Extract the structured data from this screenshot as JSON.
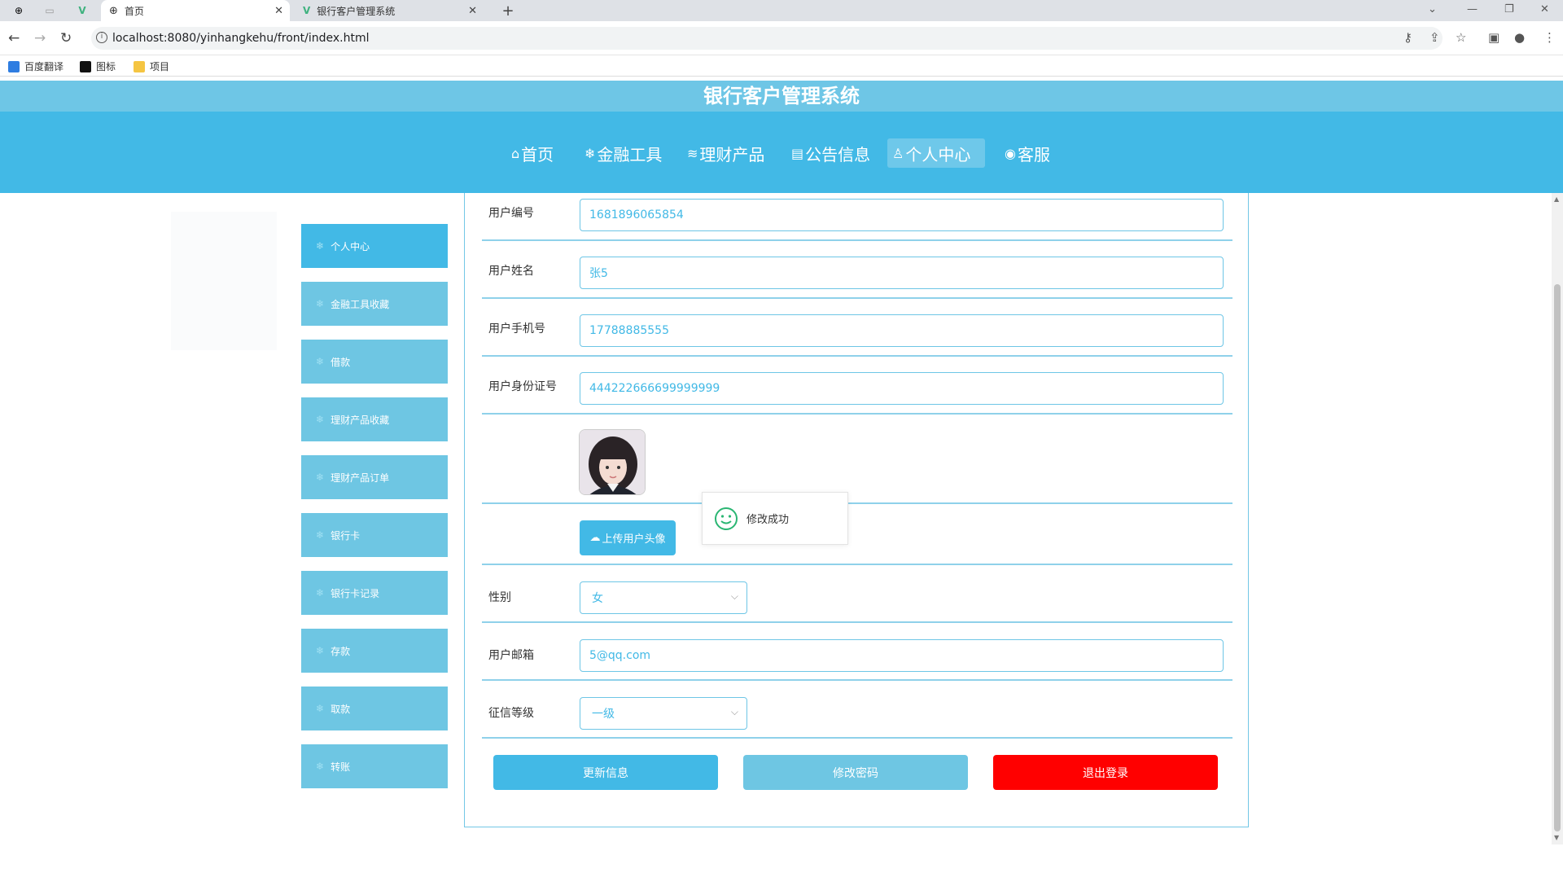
{
  "browser": {
    "tabs": [
      {
        "title": "首页",
        "active": true
      },
      {
        "title": "银行客户管理系统",
        "active": false
      }
    ],
    "url": "localhost:8080/yinhangkehu/front/index.html",
    "bookmarks": [
      "百度翻译",
      "图标",
      "项目"
    ],
    "new_tab": "+",
    "tab_close": "✕"
  },
  "site": {
    "title": "银行客户管理系统",
    "nav": [
      {
        "label": "首页",
        "icon": "home-icon",
        "active": false
      },
      {
        "label": "金融工具",
        "icon": "snowflake-icon",
        "active": false
      },
      {
        "label": "理财产品",
        "icon": "layers-icon",
        "active": false
      },
      {
        "label": "公告信息",
        "icon": "clipboard-icon",
        "active": false
      },
      {
        "label": "个人中心",
        "icon": "user-icon",
        "active": true
      },
      {
        "label": "客服",
        "icon": "chat-icon",
        "active": false
      }
    ]
  },
  "sidebar": {
    "items": [
      {
        "label": "个人中心",
        "active": true
      },
      {
        "label": "金融工具收藏",
        "active": false
      },
      {
        "label": "借款",
        "active": false
      },
      {
        "label": "理财产品收藏",
        "active": false
      },
      {
        "label": "理财产品订单",
        "active": false
      },
      {
        "label": "银行卡",
        "active": false
      },
      {
        "label": "银行卡记录",
        "active": false
      },
      {
        "label": "存款",
        "active": false
      },
      {
        "label": "取款",
        "active": false
      },
      {
        "label": "转账",
        "active": false
      }
    ]
  },
  "form": {
    "user_id": {
      "label": "用户编号",
      "value": "1681896065854"
    },
    "user_name": {
      "label": "用户姓名",
      "value": "张5"
    },
    "phone": {
      "label": "用户手机号",
      "value": "17788885555"
    },
    "id_card": {
      "label": "用户身份证号",
      "value": "444222666699999999"
    },
    "upload_label": "上传用户头像",
    "gender": {
      "label": "性别",
      "value": "女"
    },
    "email": {
      "label": "用户邮箱",
      "value": "5@qq.com"
    },
    "credit": {
      "label": "征信等级",
      "value": "一级"
    }
  },
  "toast": {
    "message": "修改成功"
  },
  "actions": {
    "update": "更新信息",
    "change_password": "修改密码",
    "logout": "退出登录"
  },
  "colors": {
    "primary": "#42b9e6",
    "light": "#6ec6e6",
    "danger": "#ff0000"
  }
}
